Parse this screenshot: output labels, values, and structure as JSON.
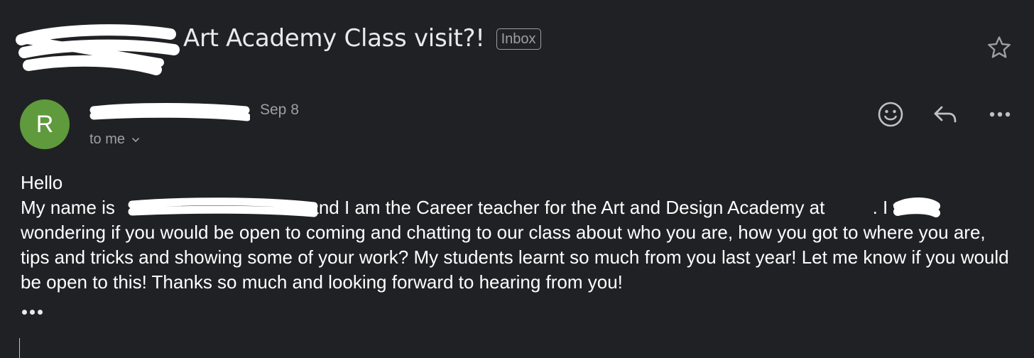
{
  "email": {
    "subject": "Art Academy Class visit?!",
    "label": "Inbox",
    "sender_initial": "R",
    "date": "Sep 8",
    "recipient": "to me",
    "greeting": "Hello",
    "body_part1": "My name is",
    "body_part2": "and I am the Career teacher for the Art and Design Academy at",
    "body_part3": ". I was wondering if you would be open to coming and chatting to our class about who you are, how you got to where you are, tips and tricks and showing some of your work? My students learnt so much from you last year! Let me know if you would be open to this! Thanks so much and looking forward to hearing from you!"
  },
  "icons": {
    "star": "star-icon",
    "emoji": "emoji-icon",
    "reply": "reply-icon",
    "more": "more-options-icon",
    "expand": "chevron-down-icon",
    "trimmed": "trimmed-content-icon"
  },
  "colors": {
    "background": "#202124",
    "avatar": "#5f9a3d",
    "redaction": "#ffffff",
    "secondary_text": "#9aa0a6"
  }
}
